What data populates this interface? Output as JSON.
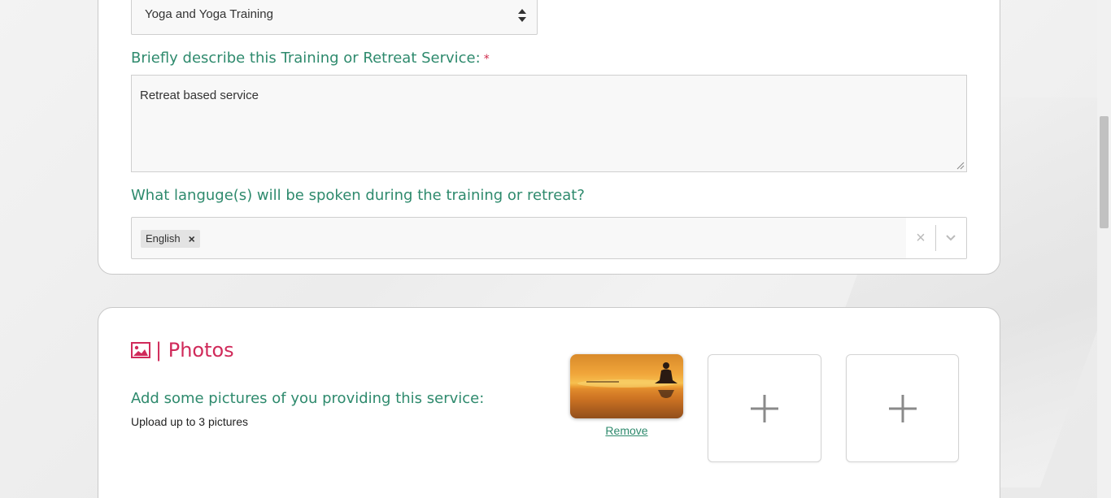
{
  "service_type_select": {
    "value": "Yoga and Yoga Training"
  },
  "description": {
    "label": "Briefly describe this Training or Retreat Service:",
    "required_mark": "*",
    "value": "Retreat based service"
  },
  "languages": {
    "label": "What languge(s) will be spoken during the training or retreat?",
    "selected": [
      "English"
    ],
    "chip_remove": "×",
    "clear_symbol": "×"
  },
  "photos": {
    "title": "| Photos",
    "subtitle": "Add some pictures of you providing this service:",
    "hint": "Upload up to 3 pictures",
    "remove_label": "Remove",
    "max": 3,
    "uploaded_count": 1
  },
  "icons": {
    "image": "image-icon",
    "plus": "plus-icon",
    "dropdown": "chevron-down-icon",
    "sort": "sort-arrows-icon"
  },
  "colors": {
    "label_green": "#2e8a6d",
    "accent_pink": "#d02a5a",
    "required_red": "#d02a4a"
  },
  "scroll": {
    "position": 0.23
  }
}
